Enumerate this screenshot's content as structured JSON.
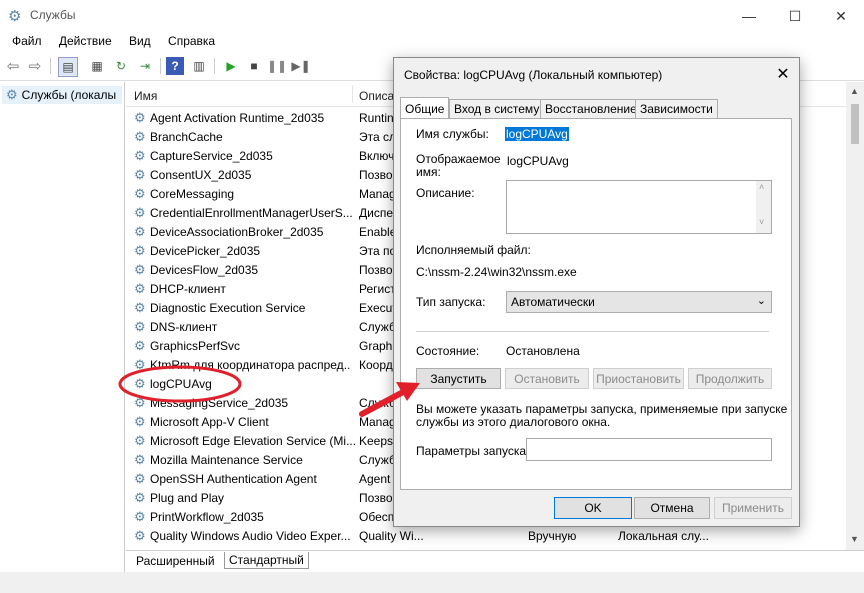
{
  "window": {
    "title": "Службы",
    "min": "—",
    "max": "☐",
    "close": "✕"
  },
  "menu": [
    "Файл",
    "Действие",
    "Вид",
    "Справка"
  ],
  "tree": {
    "selected": "Службы (локалы"
  },
  "columns": {
    "name": "Имя",
    "description": "Описа"
  },
  "services": [
    {
      "name": "Agent Activation Runtime_2d035",
      "desc": "Runtin"
    },
    {
      "name": "BranchCache",
      "desc": "Эта сл"
    },
    {
      "name": "CaptureService_2d035",
      "desc": "Включ"
    },
    {
      "name": "ConsentUX_2d035",
      "desc": "Позво"
    },
    {
      "name": "CoreMessaging",
      "desc": "Manag"
    },
    {
      "name": "CredentialEnrollmentManagerUserS...",
      "desc": "Диспе"
    },
    {
      "name": "DeviceAssociationBroker_2d035",
      "desc": "Enable"
    },
    {
      "name": "DevicePicker_2d035",
      "desc": "Эта по"
    },
    {
      "name": "DevicesFlow_2d035",
      "desc": "Позво"
    },
    {
      "name": "DHCP-клиент",
      "desc": "Регист"
    },
    {
      "name": "Diagnostic Execution Service",
      "desc": "Execut"
    },
    {
      "name": "DNS-клиент",
      "desc": "Служб"
    },
    {
      "name": "GraphicsPerfSvc",
      "desc": "Graphi"
    },
    {
      "name": "KtmRm для координатора распред...",
      "desc": "Коорд"
    },
    {
      "name": "logCPUAvg",
      "desc": ""
    },
    {
      "name": "MessagingService_2d035",
      "desc": "Служб"
    },
    {
      "name": "Microsoft App-V Client",
      "desc": "Manag"
    },
    {
      "name": "Microsoft Edge Elevation Service (Mi...",
      "desc": "Keeps"
    },
    {
      "name": "Mozilla Maintenance Service",
      "desc": "Служб"
    },
    {
      "name": "OpenSSH Authentication Agent",
      "desc": "Agent"
    },
    {
      "name": "Plug and Play",
      "desc": "Позво"
    },
    {
      "name": "PrintWorkflow_2d035",
      "desc": "Обесп"
    },
    {
      "name": "Quality Windows Audio Video Exper...",
      "desc": "Quality Wi...",
      "startup": "Вручную",
      "logon": "Локальная слу..."
    }
  ],
  "bottom_tabs": [
    "Расширенный",
    "Стандартный"
  ],
  "dialog": {
    "title": "Свойства: logCPUAvg (Локальный компьютер)",
    "close": "✕",
    "tabs": [
      "Общие",
      "Вход в систему",
      "Восстановление",
      "Зависимости"
    ],
    "service_name_label": "Имя службы:",
    "service_name": "logCPUAvg",
    "display_name_label_1": "Отображаемое",
    "display_name_label_2": "имя:",
    "display_name": "logCPUAvg",
    "description_label": "Описание:",
    "exe_label": "Исполняемый файл:",
    "exe_path": "C:\\nssm-2.24\\win32\\nssm.exe",
    "startup_type_label": "Тип запуска:",
    "startup_type": "Автоматически",
    "status_label": "Состояние:",
    "status_value": "Остановлена",
    "btn_start": "Запустить",
    "btn_stop": "Остановить",
    "btn_pause": "Приостановить",
    "btn_resume": "Продолжить",
    "hint_1": "Вы можете указать параметры запуска, применяемые при запуске",
    "hint_2": "службы из этого диалогового окна.",
    "params_label": "Параметры запуска:",
    "btn_ok": "OK",
    "btn_cancel": "Отмена",
    "btn_apply": "Применить"
  },
  "annotation_color": "#e0202a"
}
